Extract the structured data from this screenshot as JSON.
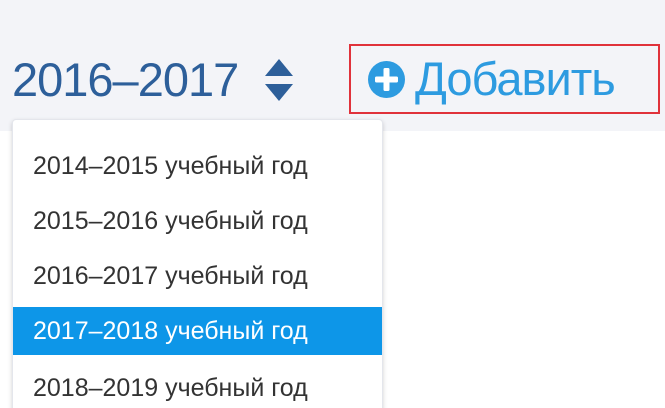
{
  "year_selector": {
    "value": "2016–2017",
    "icon": "sort-icon"
  },
  "add_button": {
    "label": "Добавить",
    "icon": "plus-circle-icon",
    "highlight_border": "#e0323b",
    "text_color": "#2d9be0"
  },
  "dropdown": {
    "options": [
      {
        "label": "2014–2015 учебный год",
        "selected": false
      },
      {
        "label": "2015–2016 учебный год",
        "selected": false
      },
      {
        "label": "2016–2017 учебный год",
        "selected": false
      },
      {
        "label": "2017–2018 учебный год",
        "selected": true
      },
      {
        "label": "2018–2019 учебный год",
        "selected": false
      }
    ],
    "selected_color": "#0d96e8"
  },
  "colors": {
    "header_background": "#f3f4f8",
    "year_text": "#2d5f9a"
  }
}
